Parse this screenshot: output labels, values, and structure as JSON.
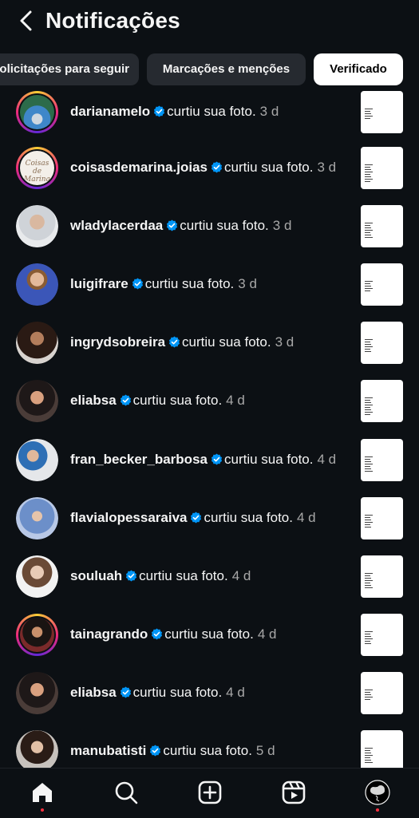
{
  "header": {
    "title": "Notificações"
  },
  "tabs": [
    {
      "label": "Solicitações para seguir"
    },
    {
      "label": "Marcações e menções"
    },
    {
      "label": "Verificado"
    }
  ],
  "notifications": [
    {
      "username": "darianamelo",
      "action": "curtiu sua foto.",
      "time": "3 d"
    },
    {
      "username": "coisasdemarina.joias",
      "action": "curtiu sua foto.",
      "time": "3 d"
    },
    {
      "username": "wladylacerdaa",
      "action": "curtiu sua foto.",
      "time": "3 d"
    },
    {
      "username": "luigifrare",
      "action": "curtiu sua foto.",
      "time": "3 d"
    },
    {
      "username": "ingrydsobreira",
      "action": "curtiu sua foto.",
      "time": "3 d"
    },
    {
      "username": "eliabsa",
      "action": "curtiu sua foto.",
      "time": "4 d"
    },
    {
      "username": "fran_becker_barbosa",
      "action": "curtiu sua foto.",
      "time": "4 d"
    },
    {
      "username": "flavialopessaraiva",
      "action": "curtiu sua foto.",
      "time": "4 d"
    },
    {
      "username": "souluah",
      "action": "curtiu sua foto.",
      "time": "4 d"
    },
    {
      "username": "tainagrando",
      "action": "curtiu sua foto.",
      "time": "4 d"
    },
    {
      "username": "eliabsa",
      "action": "curtiu sua foto.",
      "time": "4 d"
    },
    {
      "username": "manubatisti",
      "action": "curtiu sua foto.",
      "time": "5 d"
    }
  ],
  "avatar_text": {
    "coisasdemarina": "Coisas de Marina"
  },
  "nav": [
    {
      "icon": "home-icon"
    },
    {
      "icon": "search-icon"
    },
    {
      "icon": "create-icon"
    },
    {
      "icon": "reels-icon"
    },
    {
      "icon": "profile-avatar-icon"
    }
  ],
  "colors": {
    "background": "#0c1014",
    "verified": "#0095f6",
    "notification_dot": "#ff3040",
    "active_tab": "#ffffff",
    "tab": "#262a30"
  }
}
